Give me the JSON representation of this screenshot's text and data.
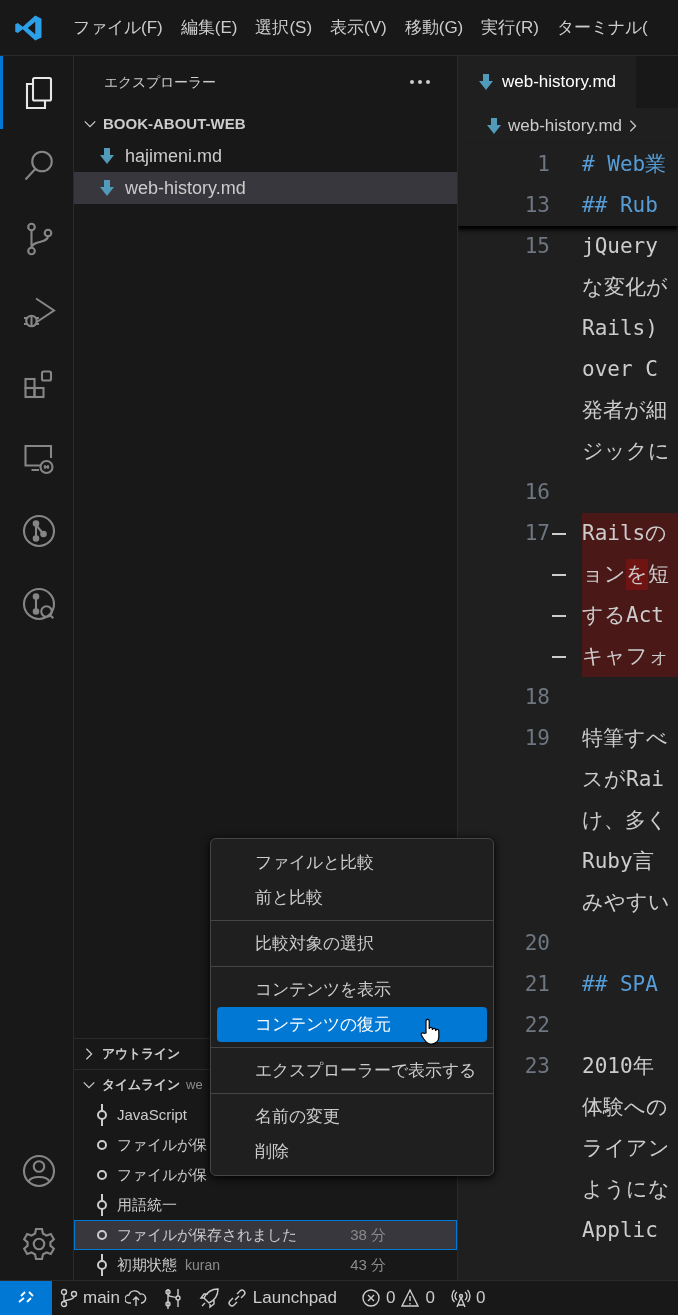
{
  "menubar": {
    "items": [
      "ファイル(F)",
      "編集(E)",
      "選択(S)",
      "表示(V)",
      "移動(G)",
      "実行(R)",
      "ターミナル("
    ]
  },
  "activity_bar": {
    "items": [
      {
        "selected": true
      },
      {
        "selected": false
      },
      {
        "selected": false
      },
      {
        "selected": false
      },
      {
        "selected": false
      },
      {
        "selected": false
      },
      {
        "selected": false
      },
      {
        "selected": false
      }
    ],
    "bottom": [
      {
        "selected": false
      },
      {
        "selected": false
      }
    ]
  },
  "sidebar": {
    "title": "エクスプローラー",
    "folder": {
      "name": "BOOK-ABOUT-WEB",
      "expanded": true,
      "files": [
        {
          "name": "hajimeni.md",
          "selected": false
        },
        {
          "name": "web-history.md",
          "selected": true
        }
      ]
    },
    "outline": {
      "title": "アウトライン",
      "expanded": false
    },
    "timeline": {
      "title": "タイムライン",
      "description": "we",
      "expanded": true,
      "items": [
        {
          "kind": "commit",
          "label": "JavaScript",
          "selected": false
        },
        {
          "kind": "save",
          "label": "ファイルが保",
          "selected": false
        },
        {
          "kind": "save",
          "label": "ファイルが保",
          "selected": false
        },
        {
          "kind": "commit",
          "label": "用語統一",
          "selected": false
        },
        {
          "kind": "save",
          "label": "ファイルが保存されました",
          "time": "38 分",
          "selected": true
        },
        {
          "kind": "commit",
          "label": "初期状態",
          "author": "kuran",
          "time": "43 分",
          "selected": false
        }
      ]
    }
  },
  "editor": {
    "tab": {
      "title": "web-history.md",
      "selected": true
    },
    "breadcrumb": [
      "web-history.md"
    ],
    "sticky_lines": [
      {
        "number": "1",
        "kind": "heading",
        "text": "# Web業"
      },
      {
        "number": "13",
        "kind": "heading",
        "text": "## Rub"
      }
    ],
    "lines": [
      {
        "number": "15",
        "kind": "text",
        "deleted": false,
        "rows": [
          "jQuery",
          "な変化が",
          "Rails)",
          "over C",
          "発者が細",
          "ジックに"
        ]
      },
      {
        "number": "16",
        "kind": "text",
        "deleted": false
      },
      {
        "number": "17",
        "kind": "text",
        "deleted": true,
        "rows": [
          "Railsの",
          [
            {
              "text": "ョン",
              "changed": false
            },
            {
              "text": "を",
              "changed": true
            },
            {
              "text": "短",
              "changed": false
            }
          ],
          "するAct",
          "キャフォ"
        ]
      },
      {
        "number": "18",
        "kind": "text",
        "deleted": false
      },
      {
        "number": "19",
        "kind": "text",
        "deleted": false,
        "rows": [
          "特筆すべ",
          "スがRai",
          "け、多く",
          "Ruby言",
          "みやすい"
        ]
      },
      {
        "number": "20",
        "kind": "text",
        "deleted": false
      },
      {
        "number": "21",
        "kind": "heading",
        "deleted": false,
        "rows": [
          "## SPA"
        ]
      },
      {
        "number": "22",
        "kind": "text",
        "deleted": false
      },
      {
        "number": "23",
        "kind": "text",
        "deleted": false,
        "rows": [
          "2010年",
          "体験への",
          "ライアン",
          "ようにな",
          "Applic"
        ]
      }
    ]
  },
  "context_menu": {
    "groups": [
      {
        "items": [
          {
            "label": "ファイルと比較",
            "selected": false
          },
          {
            "label": "前と比較",
            "selected": false
          }
        ]
      },
      {
        "items": [
          {
            "label": "比較対象の選択",
            "selected": false
          }
        ]
      },
      {
        "items": [
          {
            "label": "コンテンツを表示",
            "selected": false
          },
          {
            "label": "コンテンツの復元",
            "selected": true
          }
        ]
      },
      {
        "items": [
          {
            "label": "エクスプローラーで表示する",
            "selected": false
          }
        ]
      },
      {
        "items": [
          {
            "label": "名前の変更",
            "selected": false
          },
          {
            "label": "削除",
            "selected": false
          }
        ]
      }
    ]
  },
  "status_bar": {
    "branch": "main",
    "launchpad": "Launchpad",
    "errors": "0",
    "warnings": "0",
    "ports": "0"
  }
}
